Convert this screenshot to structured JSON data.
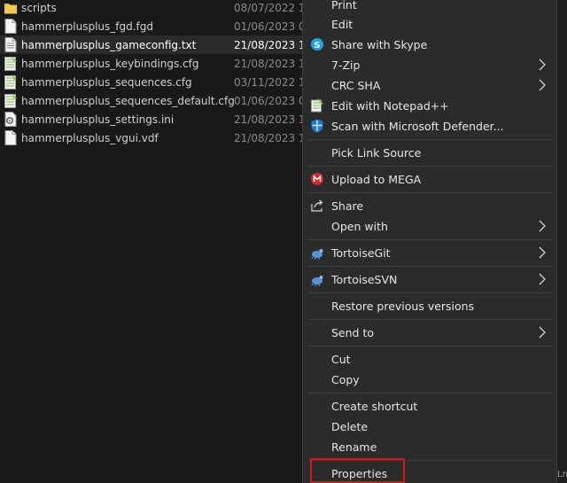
{
  "files": [
    {
      "name": "scripts",
      "date": "08/07/2022 1",
      "icon": "folder-icon",
      "selected": false
    },
    {
      "name": "hammerplusplus_fgd.fgd",
      "date": "01/06/2023 0",
      "icon": "file-icon",
      "selected": false
    },
    {
      "name": "hammerplusplus_gameconfig.txt",
      "date": "21/08/2023 1",
      "icon": "file-icon",
      "selected": true
    },
    {
      "name": "hammerplusplus_keybindings.cfg",
      "date": "21/08/2023 1",
      "icon": "notepadpp-file-icon",
      "selected": false
    },
    {
      "name": "hammerplusplus_sequences.cfg",
      "date": "03/11/2022 1",
      "icon": "notepadpp-file-icon",
      "selected": false
    },
    {
      "name": "hammerplusplus_sequences_default.cfg",
      "date": "01/06/2023 0",
      "icon": "notepadpp-file-icon",
      "selected": false
    },
    {
      "name": "hammerplusplus_settings.ini",
      "date": "21/08/2023 1",
      "icon": "settings-file-icon",
      "selected": false
    },
    {
      "name": "hammerplusplus_vgui.vdf",
      "date": "21/08/2023 1",
      "icon": "file-icon",
      "selected": false
    }
  ],
  "menu": {
    "print": "Print",
    "edit": "Edit",
    "skype": "Share with Skype",
    "zip": "7-Zip",
    "crc": "CRC SHA",
    "notepad": "Edit with Notepad++",
    "defender": "Scan with Microsoft Defender...",
    "pick_link": "Pick Link Source",
    "mega": "Upload to MEGA",
    "share": "Share",
    "open_with": "Open with",
    "git": "TortoiseGit",
    "svn": "TortoiseSVN",
    "restore": "Restore previous versions",
    "send_to": "Send to",
    "cut": "Cut",
    "copy": "Copy",
    "shortcut": "Create shortcut",
    "delete": "Delete",
    "rename": "Rename",
    "properties": "Properties"
  },
  "right_edge_text": "Ln",
  "colors": {
    "highlight_border": "#d0181a",
    "background": "#191919",
    "menu_bg": "#2b2b2b"
  }
}
